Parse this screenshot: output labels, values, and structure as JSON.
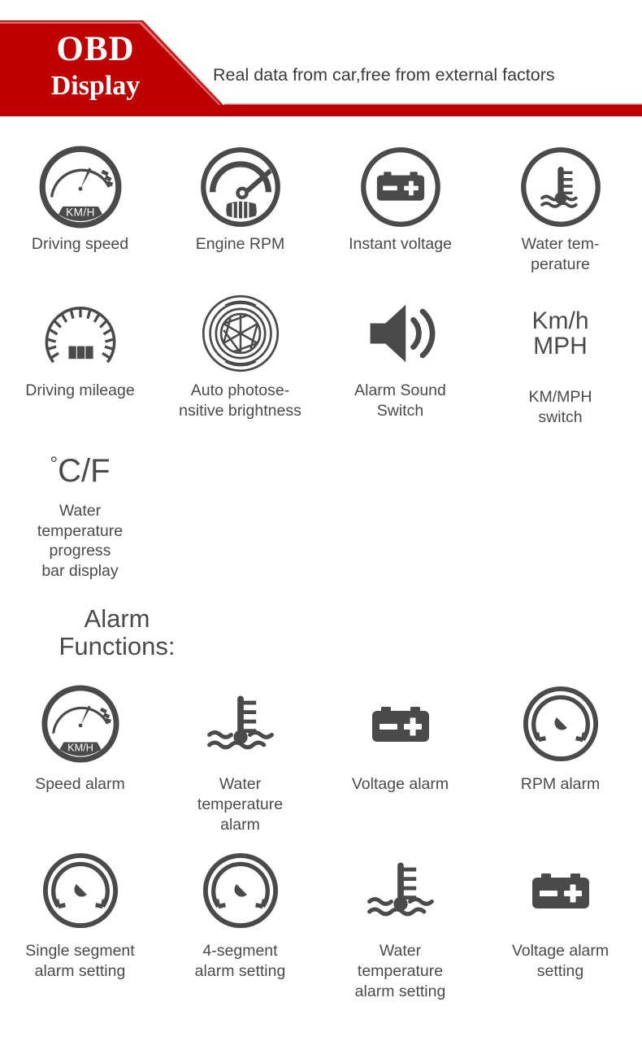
{
  "header": {
    "brand_line1": "OBD",
    "brand_line2": "Display",
    "tagline": "Real data from car,free from external factors",
    "banner_color": "#BE0000",
    "banner_text_color": "#FFFFFF"
  },
  "theme": {
    "icon_color": "#4a4a4a",
    "text_color": "#4a4a4a",
    "background": "#FFFFFF"
  },
  "features": {
    "row1": [
      {
        "icon": "speedometer-kmh-icon",
        "label": "Driving speed",
        "gauge_unit": "KM/H"
      },
      {
        "icon": "engine-rpm-gauge-icon",
        "label": "Engine RPM"
      },
      {
        "icon": "car-battery-icon",
        "label": "Instant voltage"
      },
      {
        "icon": "water-temperature-icon",
        "label": "Water tem-\nperature"
      }
    ],
    "row2": [
      {
        "icon": "odometer-mileage-icon",
        "label": "Driving mileage"
      },
      {
        "icon": "aperture-photosensor-icon",
        "label": "Auto photose-\nnsitive brightness"
      },
      {
        "icon": "speaker-sound-icon",
        "label": "Alarm Sound\nSwitch"
      },
      {
        "icon": "km-mph-text-icon",
        "icon_text_line1": "Km/h",
        "icon_text_line2": "MPH",
        "label": "KM/MPH\nswitch"
      }
    ]
  },
  "water_temp_unit": {
    "symbol_degree": "°",
    "symbol_text": "C/F",
    "label": "Water\ntemperature\nprogress\nbar display"
  },
  "alarm_section": {
    "heading_line1": "Alarm",
    "heading_line2": "Functions:",
    "row1": [
      {
        "icon": "speedometer-kmh-icon",
        "label": "Speed alarm",
        "gauge_unit": "KM/H"
      },
      {
        "icon": "water-temperature-icon",
        "label": "Water\ntemperature\nalarm"
      },
      {
        "icon": "car-battery-icon",
        "label": "Voltage alarm"
      },
      {
        "icon": "rpm-needle-gauge-icon",
        "label": "RPM alarm"
      }
    ],
    "row2": [
      {
        "icon": "rpm-needle-gauge-icon",
        "label": "Single segment\nalarm setting"
      },
      {
        "icon": "rpm-needle-gauge-icon",
        "label": "4-segment\nalarm setting"
      },
      {
        "icon": "water-temperature-icon",
        "label": "Water\ntemperature\nalarm setting"
      },
      {
        "icon": "car-battery-icon",
        "label": "Voltage alarm\nsetting"
      }
    ]
  }
}
